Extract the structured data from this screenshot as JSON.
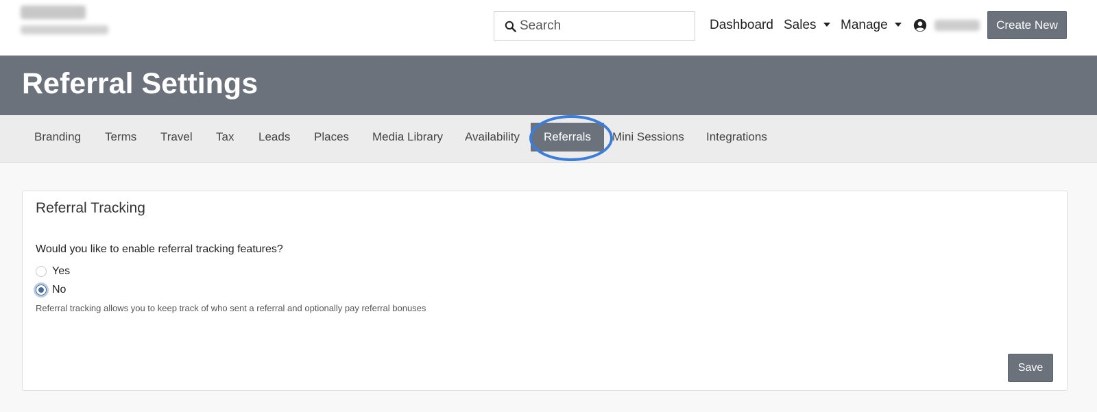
{
  "navbar": {
    "search_placeholder": "Search",
    "links": {
      "dashboard": "Dashboard",
      "sales": "Sales",
      "manage": "Manage"
    },
    "create_new_label": "Create New",
    "icons": {
      "search": "search-icon",
      "user": "user-circle-icon",
      "caret": "caret-down-icon"
    }
  },
  "header": {
    "title": "Referral Settings"
  },
  "tabs": [
    {
      "label": "Branding",
      "active": false
    },
    {
      "label": "Terms",
      "active": false
    },
    {
      "label": "Travel",
      "active": false
    },
    {
      "label": "Tax",
      "active": false
    },
    {
      "label": "Leads",
      "active": false
    },
    {
      "label": "Places",
      "active": false
    },
    {
      "label": "Media Library",
      "active": false
    },
    {
      "label": "Availability",
      "active": false
    },
    {
      "label": "Referrals",
      "active": true
    },
    {
      "label": "Mini Sessions",
      "active": false
    },
    {
      "label": "Integrations",
      "active": false
    }
  ],
  "card": {
    "title": "Referral Tracking",
    "question": "Would you like to enable referral tracking features?",
    "options": {
      "yes": {
        "label": "Yes",
        "checked": false
      },
      "no": {
        "label": "No",
        "checked": true
      }
    },
    "help_text": "Referral tracking allows you to keep track of who sent a referral and optionally pay referral bonuses",
    "save_label": "Save"
  },
  "colors": {
    "header_band": "#6b727b",
    "button_bg": "#6b727b",
    "highlight_ring": "#3b7dd8",
    "tabs_bg": "#ececec",
    "page_bg": "#f8f8f8"
  }
}
